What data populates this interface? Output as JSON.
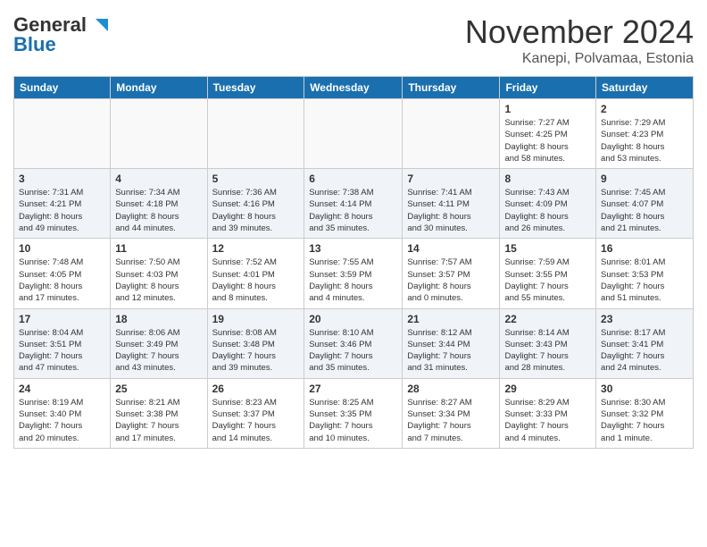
{
  "header": {
    "logo": {
      "general": "General",
      "blue": "Blue"
    },
    "title": "November 2024",
    "location": "Kanepi, Polvamaa, Estonia"
  },
  "days_of_week": [
    "Sunday",
    "Monday",
    "Tuesday",
    "Wednesday",
    "Thursday",
    "Friday",
    "Saturday"
  ],
  "weeks": [
    [
      {
        "day": "",
        "info": ""
      },
      {
        "day": "",
        "info": ""
      },
      {
        "day": "",
        "info": ""
      },
      {
        "day": "",
        "info": ""
      },
      {
        "day": "",
        "info": ""
      },
      {
        "day": "1",
        "info": "Sunrise: 7:27 AM\nSunset: 4:25 PM\nDaylight: 8 hours\nand 58 minutes."
      },
      {
        "day": "2",
        "info": "Sunrise: 7:29 AM\nSunset: 4:23 PM\nDaylight: 8 hours\nand 53 minutes."
      }
    ],
    [
      {
        "day": "3",
        "info": "Sunrise: 7:31 AM\nSunset: 4:21 PM\nDaylight: 8 hours\nand 49 minutes."
      },
      {
        "day": "4",
        "info": "Sunrise: 7:34 AM\nSunset: 4:18 PM\nDaylight: 8 hours\nand 44 minutes."
      },
      {
        "day": "5",
        "info": "Sunrise: 7:36 AM\nSunset: 4:16 PM\nDaylight: 8 hours\nand 39 minutes."
      },
      {
        "day": "6",
        "info": "Sunrise: 7:38 AM\nSunset: 4:14 PM\nDaylight: 8 hours\nand 35 minutes."
      },
      {
        "day": "7",
        "info": "Sunrise: 7:41 AM\nSunset: 4:11 PM\nDaylight: 8 hours\nand 30 minutes."
      },
      {
        "day": "8",
        "info": "Sunrise: 7:43 AM\nSunset: 4:09 PM\nDaylight: 8 hours\nand 26 minutes."
      },
      {
        "day": "9",
        "info": "Sunrise: 7:45 AM\nSunset: 4:07 PM\nDaylight: 8 hours\nand 21 minutes."
      }
    ],
    [
      {
        "day": "10",
        "info": "Sunrise: 7:48 AM\nSunset: 4:05 PM\nDaylight: 8 hours\nand 17 minutes."
      },
      {
        "day": "11",
        "info": "Sunrise: 7:50 AM\nSunset: 4:03 PM\nDaylight: 8 hours\nand 12 minutes."
      },
      {
        "day": "12",
        "info": "Sunrise: 7:52 AM\nSunset: 4:01 PM\nDaylight: 8 hours\nand 8 minutes."
      },
      {
        "day": "13",
        "info": "Sunrise: 7:55 AM\nSunset: 3:59 PM\nDaylight: 8 hours\nand 4 minutes."
      },
      {
        "day": "14",
        "info": "Sunrise: 7:57 AM\nSunset: 3:57 PM\nDaylight: 8 hours\nand 0 minutes."
      },
      {
        "day": "15",
        "info": "Sunrise: 7:59 AM\nSunset: 3:55 PM\nDaylight: 7 hours\nand 55 minutes."
      },
      {
        "day": "16",
        "info": "Sunrise: 8:01 AM\nSunset: 3:53 PM\nDaylight: 7 hours\nand 51 minutes."
      }
    ],
    [
      {
        "day": "17",
        "info": "Sunrise: 8:04 AM\nSunset: 3:51 PM\nDaylight: 7 hours\nand 47 minutes."
      },
      {
        "day": "18",
        "info": "Sunrise: 8:06 AM\nSunset: 3:49 PM\nDaylight: 7 hours\nand 43 minutes."
      },
      {
        "day": "19",
        "info": "Sunrise: 8:08 AM\nSunset: 3:48 PM\nDaylight: 7 hours\nand 39 minutes."
      },
      {
        "day": "20",
        "info": "Sunrise: 8:10 AM\nSunset: 3:46 PM\nDaylight: 7 hours\nand 35 minutes."
      },
      {
        "day": "21",
        "info": "Sunrise: 8:12 AM\nSunset: 3:44 PM\nDaylight: 7 hours\nand 31 minutes."
      },
      {
        "day": "22",
        "info": "Sunrise: 8:14 AM\nSunset: 3:43 PM\nDaylight: 7 hours\nand 28 minutes."
      },
      {
        "day": "23",
        "info": "Sunrise: 8:17 AM\nSunset: 3:41 PM\nDaylight: 7 hours\nand 24 minutes."
      }
    ],
    [
      {
        "day": "24",
        "info": "Sunrise: 8:19 AM\nSunset: 3:40 PM\nDaylight: 7 hours\nand 20 minutes."
      },
      {
        "day": "25",
        "info": "Sunrise: 8:21 AM\nSunset: 3:38 PM\nDaylight: 7 hours\nand 17 minutes."
      },
      {
        "day": "26",
        "info": "Sunrise: 8:23 AM\nSunset: 3:37 PM\nDaylight: 7 hours\nand 14 minutes."
      },
      {
        "day": "27",
        "info": "Sunrise: 8:25 AM\nSunset: 3:35 PM\nDaylight: 7 hours\nand 10 minutes."
      },
      {
        "day": "28",
        "info": "Sunrise: 8:27 AM\nSunset: 3:34 PM\nDaylight: 7 hours\nand 7 minutes."
      },
      {
        "day": "29",
        "info": "Sunrise: 8:29 AM\nSunset: 3:33 PM\nDaylight: 7 hours\nand 4 minutes."
      },
      {
        "day": "30",
        "info": "Sunrise: 8:30 AM\nSunset: 3:32 PM\nDaylight: 7 hours\nand 1 minute."
      }
    ]
  ]
}
